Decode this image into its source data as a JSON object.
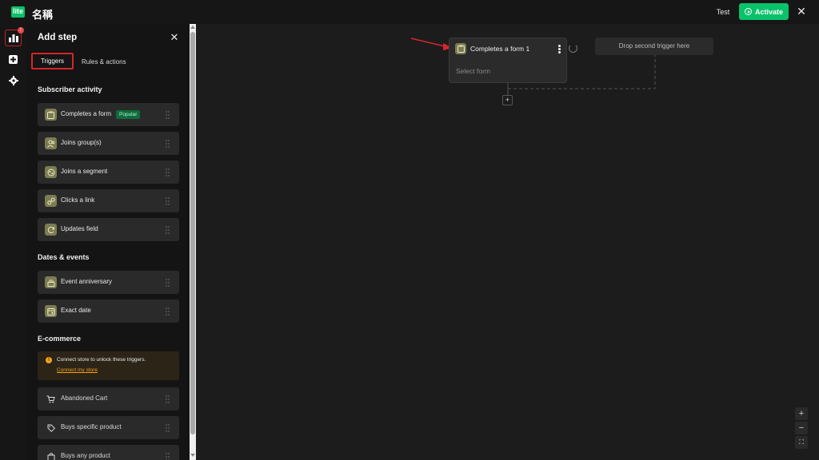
{
  "header": {
    "logo_text": "lite",
    "title": "名稱",
    "test_label": "Test",
    "activate_label": "Activate",
    "close_icon": "close-icon"
  },
  "rail": {
    "items": [
      {
        "name": "stats-icon",
        "badge": "!"
      },
      {
        "name": "add-step-icon"
      },
      {
        "name": "settings-icon"
      }
    ]
  },
  "panel": {
    "title": "Add step",
    "tabs": [
      {
        "label": "Triggers",
        "selected": true
      },
      {
        "label": "Rules & actions",
        "selected": false
      }
    ],
    "sections": {
      "subscriber_activity": {
        "heading": "Subscriber activity",
        "items": [
          {
            "label": "Completes a form",
            "badge": "Popular",
            "icon": "clipboard-icon"
          },
          {
            "label": "Joins group(s)",
            "icon": "group-icon"
          },
          {
            "label": "Joins a segment",
            "icon": "segment-icon"
          },
          {
            "label": "Clicks a link",
            "icon": "link-icon"
          },
          {
            "label": "Updates field",
            "icon": "refresh-icon"
          }
        ]
      },
      "dates_events": {
        "heading": "Dates & events",
        "items": [
          {
            "label": "Event anniversary",
            "icon": "cake-icon"
          },
          {
            "label": "Exact date",
            "icon": "calendar-icon"
          }
        ]
      },
      "ecommerce": {
        "heading": "E-commerce",
        "note": "Connect store to unlock these triggers.",
        "note_link": "Connect my store",
        "items": [
          {
            "label": "Abandoned Cart",
            "icon": "cart-icon"
          },
          {
            "label": "Buys specific product",
            "icon": "tag-icon"
          },
          {
            "label": "Buys any product",
            "icon": "bag-icon"
          }
        ]
      }
    }
  },
  "canvas": {
    "node": {
      "title": "Completes a form 1",
      "subtitle": "Select form"
    },
    "drop_zone": "Drop second trigger here",
    "add_step": "+",
    "zoom": {
      "in": "+",
      "out": "−",
      "fit": "⛶"
    }
  },
  "colors": {
    "accent": "#09c269",
    "highlight_outline": "#d6252b",
    "annotation_arrow": "#d6252b",
    "popular_badge": "#0f6b3b",
    "warning": "#f3a31a"
  }
}
